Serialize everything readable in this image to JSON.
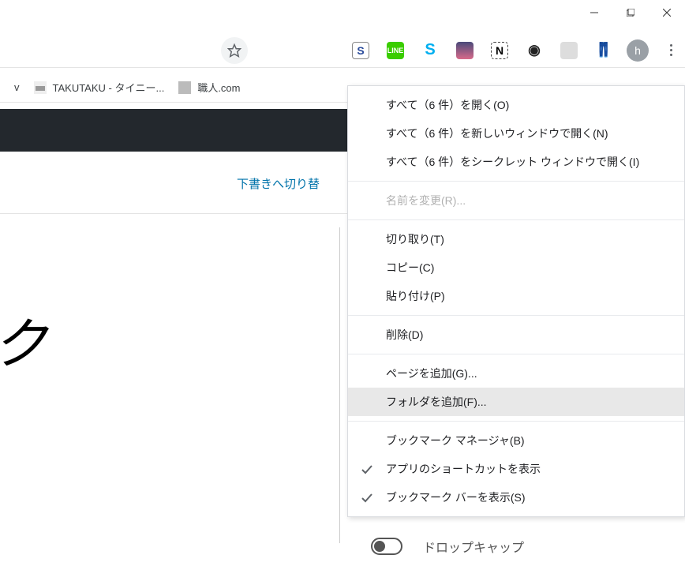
{
  "window": {
    "minimize": "—",
    "maximize": "❐",
    "close": "✕"
  },
  "toolbar": {
    "star_title": "このページをブックマーク",
    "avatar_letter": "h",
    "extensions": [
      {
        "name": "S",
        "class": "ic-s"
      },
      {
        "name": "LINE",
        "class": "ic-line"
      },
      {
        "name": "S",
        "class": "ic-skype"
      },
      {
        "name": "",
        "class": "ic-phone"
      },
      {
        "name": "N",
        "class": "ic-n"
      },
      {
        "name": "◉",
        "class": "ic-record"
      },
      {
        "name": "",
        "class": "ic-grey"
      },
      {
        "name": "👖",
        "class": "ic-pants"
      }
    ]
  },
  "bookmarks": [
    {
      "label": "v"
    },
    {
      "label": "TAKUTAKU - タイニー..."
    },
    {
      "label": "職人.com"
    }
  ],
  "page": {
    "link_text": "下書きへ切り替",
    "big_glyph": "ク",
    "dropcap_label": "ドロップキャップ"
  },
  "context_menu": {
    "items": [
      {
        "label": "すべて（6 件）を開く(O)",
        "type": "item"
      },
      {
        "label": "すべて（6 件）を新しいウィンドウで開く(N)",
        "type": "item"
      },
      {
        "label": "すべて（6 件）をシークレット ウィンドウで開く(I)",
        "type": "item"
      },
      {
        "type": "sep"
      },
      {
        "label": "名前を変更(R)...",
        "type": "item",
        "disabled": true
      },
      {
        "type": "sep"
      },
      {
        "label": "切り取り(T)",
        "type": "item"
      },
      {
        "label": "コピー(C)",
        "type": "item"
      },
      {
        "label": "貼り付け(P)",
        "type": "item"
      },
      {
        "type": "sep"
      },
      {
        "label": "削除(D)",
        "type": "item"
      },
      {
        "type": "sep"
      },
      {
        "label": "ページを追加(G)...",
        "type": "item"
      },
      {
        "label": "フォルダを追加(F)...",
        "type": "item",
        "hovered": true
      },
      {
        "type": "sep"
      },
      {
        "label": "ブックマーク マネージャ(B)",
        "type": "item"
      },
      {
        "label": "アプリのショートカットを表示",
        "type": "item",
        "checked": true
      },
      {
        "label": "ブックマーク バーを表示(S)",
        "type": "item",
        "checked": true
      }
    ]
  }
}
